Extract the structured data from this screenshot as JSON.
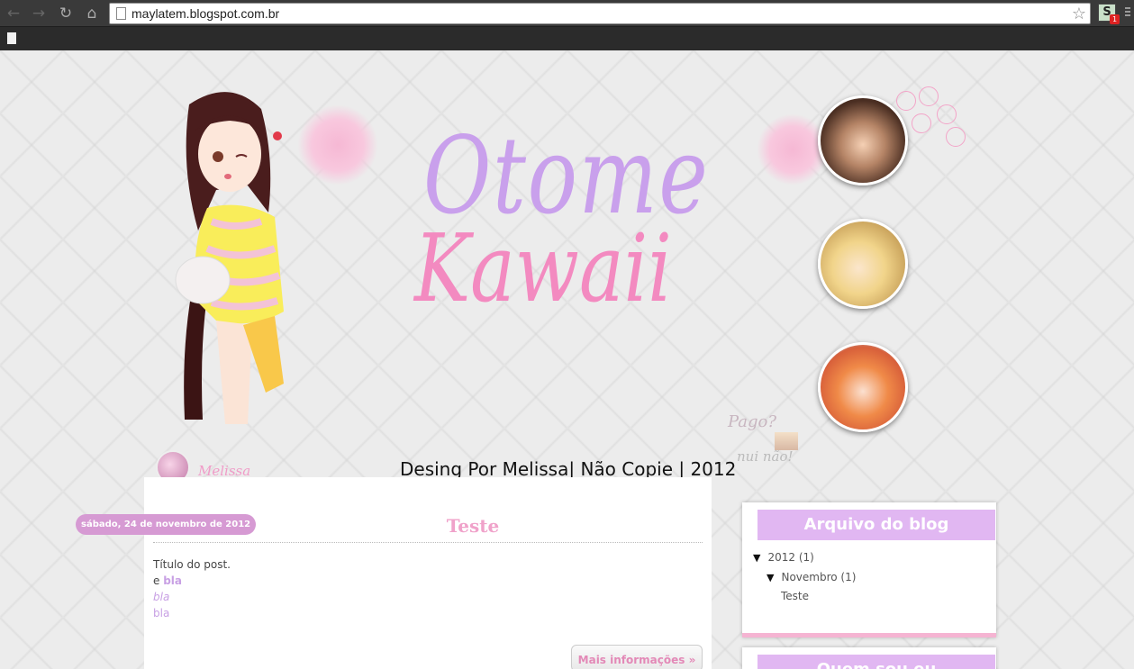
{
  "browser": {
    "url": "maylatem.blogspot.com.br",
    "extension_letter": "S",
    "extension_badge": "1"
  },
  "header": {
    "logo_line1": "Otome",
    "logo_line2": "Kawaii",
    "credit": "Desing Por Melissa| Não Copie  |  2012",
    "signature": "Melissa",
    "stamp_text1": "Pago?",
    "stamp_text2": "nui não!"
  },
  "post": {
    "date": "sábado, 24 de novembro de 2012",
    "title": "Teste",
    "line1": "Título do post.",
    "line2_prefix": "e ",
    "line2_bold": "bla",
    "line3_italic": "bla",
    "line4": "bla",
    "more_label": "Mais informações »"
  },
  "sidebar": {
    "archive_title": "Arquivo do blog",
    "year": "2012",
    "year_count": "(1)",
    "month": "Novembro",
    "month_count": "(1)",
    "post_link": "Teste",
    "next_widget_title": "Quem sou eu"
  },
  "colors": {
    "accent_pink": "#f38ac0",
    "accent_lilac": "#e1b7f2",
    "date_badge": "#d69ad3"
  },
  "icons": [
    "back-icon",
    "forward-icon",
    "reload-icon",
    "home-icon",
    "page-icon",
    "star-icon",
    "menu-icon"
  ]
}
